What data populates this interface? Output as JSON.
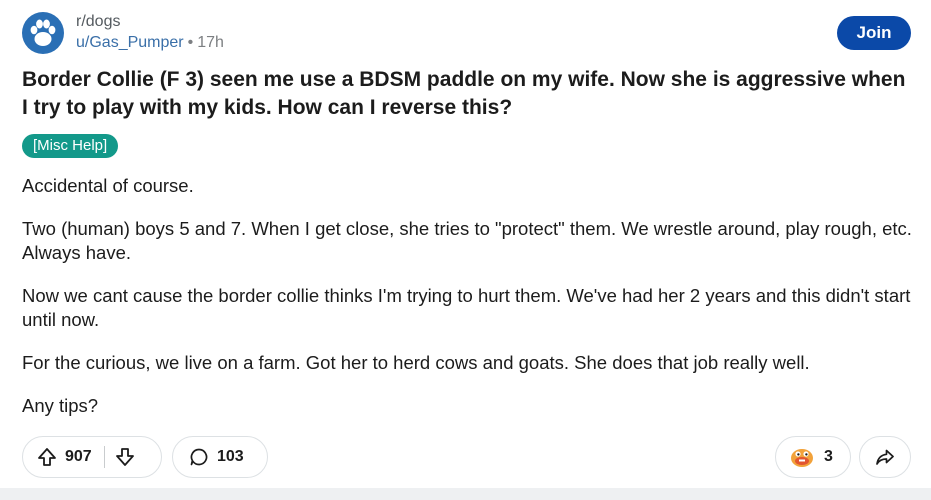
{
  "post": {
    "subreddit": "r/dogs",
    "author": "u/Gas_Pumper",
    "separator": "•",
    "age": "17h",
    "join_label": "Join",
    "title": "Border Collie (F 3) seen me use a BDSM paddle on my wife. Now she is aggressive when I try to play with my kids. How can I reverse this?",
    "flair": "[Misc Help]",
    "paragraphs": [
      "Accidental of course.",
      "Two (human) boys 5 and 7. When I get close, she tries to \"protect\" them. We wrestle around, play rough, etc. Always have.",
      "Now we cant cause the border collie thinks I'm trying to hurt them.  We've had her 2 years and this didn't start until now.",
      "For the curious, we live on a farm. Got her to herd cows and goats. She does that job really well.",
      "Any tips?"
    ]
  },
  "actions": {
    "upvotes": "907",
    "comments": "103",
    "awards": "3"
  },
  "colors": {
    "join_bg": "#0b49a8",
    "flair_bg": "#13998a",
    "avatar_bg": "#2a6fb5",
    "author": "#3a6fa8"
  },
  "icons": [
    "paw-icon",
    "upvote-arrow-icon",
    "downvote-arrow-icon",
    "comment-bubble-icon",
    "award-icon",
    "share-arrow-icon"
  ]
}
